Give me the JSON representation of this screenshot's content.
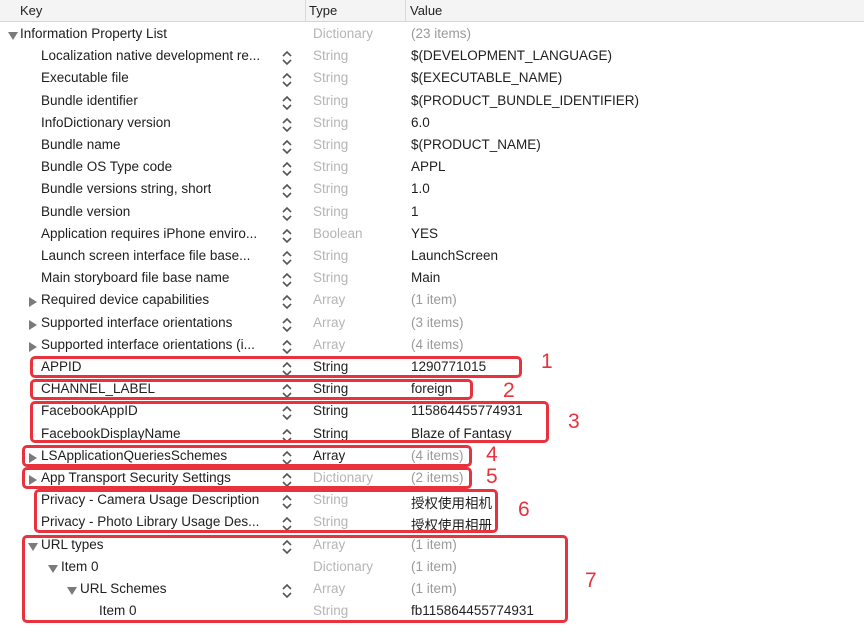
{
  "header": {
    "key": "Key",
    "type": "Type",
    "value": "Value"
  },
  "rows": [
    {
      "key": "Information Property List",
      "type": "Dictionary",
      "value": "(23 items)"
    },
    {
      "key": "Localization native development re...",
      "type": "String",
      "value": "$(DEVELOPMENT_LANGUAGE)"
    },
    {
      "key": "Executable file",
      "type": "String",
      "value": "$(EXECUTABLE_NAME)"
    },
    {
      "key": "Bundle identifier",
      "type": "String",
      "value": "$(PRODUCT_BUNDLE_IDENTIFIER)"
    },
    {
      "key": "InfoDictionary version",
      "type": "String",
      "value": "6.0"
    },
    {
      "key": "Bundle name",
      "type": "String",
      "value": "$(PRODUCT_NAME)"
    },
    {
      "key": "Bundle OS Type code",
      "type": "String",
      "value": "APPL"
    },
    {
      "key": "Bundle versions string, short",
      "type": "String",
      "value": "1.0"
    },
    {
      "key": "Bundle version",
      "type": "String",
      "value": "1"
    },
    {
      "key": "Application requires iPhone enviro...",
      "type": "Boolean",
      "value": "YES"
    },
    {
      "key": "Launch screen interface file base...",
      "type": "String",
      "value": "LaunchScreen"
    },
    {
      "key": "Main storyboard file base name",
      "type": "String",
      "value": "Main"
    },
    {
      "key": "Required device capabilities",
      "type": "Array",
      "value": "(1 item)"
    },
    {
      "key": "Supported interface orientations",
      "type": "Array",
      "value": "(3 items)"
    },
    {
      "key": "Supported interface orientations (i...",
      "type": "Array",
      "value": "(4 items)"
    },
    {
      "key": "APPID",
      "type": "String",
      "value": "1290771015"
    },
    {
      "key": "CHANNEL_LABEL",
      "type": "String",
      "value": "foreign"
    },
    {
      "key": "FacebookAppID",
      "type": "String",
      "value": "115864455774931"
    },
    {
      "key": "FacebookDisplayName",
      "type": "String",
      "value": "Blaze of Fantasy"
    },
    {
      "key": "LSApplicationQueriesSchemes",
      "type": "Array",
      "value": "(4 items)"
    },
    {
      "key": "App Transport Security Settings",
      "type": "Dictionary",
      "value": "(2 items)"
    },
    {
      "key": "Privacy - Camera Usage Description",
      "type": "String",
      "value": "授权使用相机"
    },
    {
      "key": "Privacy - Photo Library Usage Des...",
      "type": "String",
      "value": "授权使用相册"
    },
    {
      "key": "URL types",
      "type": "Array",
      "value": "(1 item)"
    },
    {
      "key": "Item 0",
      "type": "Dictionary",
      "value": "(1 item)"
    },
    {
      "key": "URL Schemes",
      "type": "Array",
      "value": "(1 item)"
    },
    {
      "key": "Item 0",
      "type": "String",
      "value": "fb115864455774931"
    }
  ],
  "annotations": [
    "1",
    "2",
    "3",
    "4",
    "5",
    "6",
    "7"
  ],
  "colors": {
    "annotation": "#e8333f",
    "muted_type": "#b5b5b5",
    "header_bg": "#f4f4f4"
  }
}
